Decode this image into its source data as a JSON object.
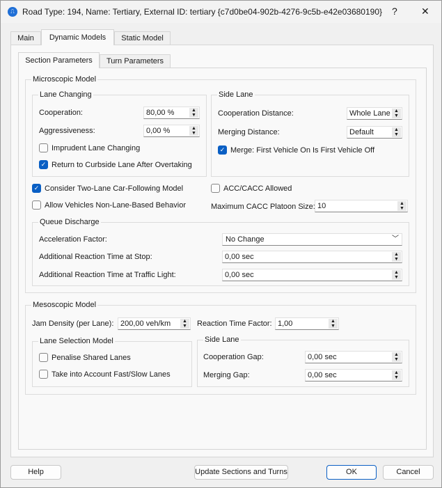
{
  "window": {
    "title": "Road Type: 194, Name: Tertiary, External ID: tertiary  {c7d0be04-902b-4276-9c5b-e42e03680190}",
    "help": "?",
    "close": "✕",
    "icon": "app-icon"
  },
  "tabs": [
    "Main",
    "Dynamic Models",
    "Static Model"
  ],
  "subtabs": [
    "Section Parameters",
    "Turn Parameters"
  ],
  "micro": {
    "title": "Microscopic Model",
    "lane_changing": {
      "title": "Lane Changing",
      "cooperation_label": "Cooperation:",
      "cooperation": "80,00 %",
      "aggr_label": "Aggressiveness:",
      "aggr": "0,00 %",
      "imprudent": "Imprudent Lane Changing",
      "imprudent_checked": false,
      "return": "Return to Curbside Lane After Overtaking",
      "return_checked": true
    },
    "side_lane": {
      "title": "Side Lane",
      "coop_dist_label": "Cooperation Distance:",
      "coop_dist": "Whole Lane",
      "merge_dist_label": "Merging Distance:",
      "merge_dist": "Default",
      "merge_first": "Merge: First Vehicle On Is First Vehicle Off",
      "merge_first_checked": true
    },
    "two_lane": "Consider Two-Lane Car-Following Model",
    "two_lane_checked": true,
    "non_lane": "Allow Vehicles Non-Lane-Based Behavior",
    "non_lane_checked": false,
    "acc": "ACC/CACC Allowed",
    "acc_checked": false,
    "platoon_label": "Maximum CACC Platoon Size:",
    "platoon": "10",
    "queue": {
      "title": "Queue Discharge",
      "accel_label": "Acceleration Factor:",
      "accel": "No Change",
      "stop_label": "Additional Reaction Time at Stop:",
      "stop": "0,00 sec",
      "light_label": "Additional Reaction Time at Traffic Light:",
      "light": "0,00 sec"
    }
  },
  "meso": {
    "title": "Mesoscopic Model",
    "jam_label": "Jam Density (per Lane):",
    "jam": "200,00 veh/km",
    "rtf_label": "Reaction Time Factor:",
    "rtf": "1,00",
    "lane_sel": {
      "title": "Lane Selection Model",
      "penalise": "Penalise Shared Lanes",
      "penalise_checked": false,
      "fastslow": "Take into Account Fast/Slow Lanes",
      "fastslow_checked": false
    },
    "side_lane": {
      "title": "Side Lane",
      "coop_gap_label": "Cooperation Gap:",
      "coop_gap": "0,00 sec",
      "merge_gap_label": "Merging Gap:",
      "merge_gap": "0,00 sec"
    }
  },
  "buttons": {
    "help": "Help",
    "update": "Update Sections and Turns",
    "ok": "OK",
    "cancel": "Cancel"
  }
}
